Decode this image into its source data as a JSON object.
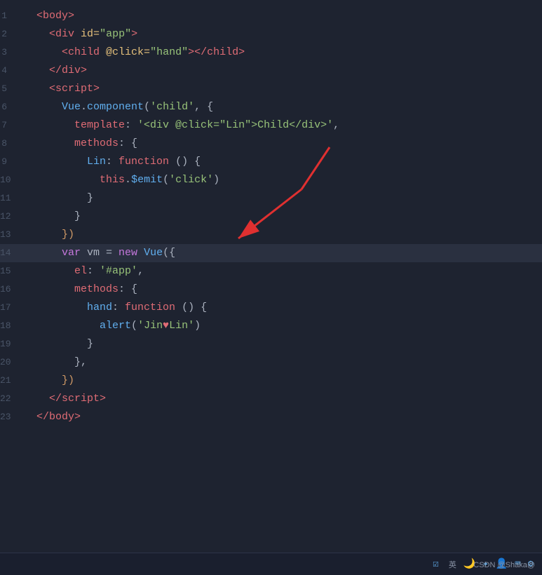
{
  "editor": {
    "background": "#1e2330",
    "lines": [
      {
        "num": "1",
        "tokens": [
          {
            "text": "  <",
            "class": "c-tag"
          },
          {
            "text": "body",
            "class": "c-tag"
          },
          {
            "text": ">",
            "class": "c-tag"
          }
        ]
      },
      {
        "num": "2",
        "tokens": [
          {
            "text": "    <",
            "class": "c-tag"
          },
          {
            "text": "div",
            "class": "c-tag"
          },
          {
            "text": " ",
            "class": "c-white"
          },
          {
            "text": "id=",
            "class": "c-attr"
          },
          {
            "text": "\"app\"",
            "class": "c-string"
          },
          {
            "text": ">",
            "class": "c-tag"
          }
        ]
      },
      {
        "num": "3",
        "tokens": [
          {
            "text": "      <",
            "class": "c-tag"
          },
          {
            "text": "child",
            "class": "c-tag"
          },
          {
            "text": " ",
            "class": "c-white"
          },
          {
            "text": "@click=",
            "class": "c-attr"
          },
          {
            "text": "\"hand\"",
            "class": "c-string"
          },
          {
            "text": ">",
            "class": "c-tag"
          },
          {
            "text": "</",
            "class": "c-tag"
          },
          {
            "text": "child",
            "class": "c-tag"
          },
          {
            "text": ">",
            "class": "c-tag"
          }
        ]
      },
      {
        "num": "4",
        "tokens": [
          {
            "text": "    </",
            "class": "c-tag"
          },
          {
            "text": "div",
            "class": "c-tag"
          },
          {
            "text": ">",
            "class": "c-tag"
          }
        ]
      },
      {
        "num": "5",
        "tokens": [
          {
            "text": "    <",
            "class": "c-tag"
          },
          {
            "text": "script",
            "class": "c-tag"
          },
          {
            "text": ">",
            "class": "c-tag"
          }
        ]
      },
      {
        "num": "6",
        "tokens": [
          {
            "text": "      ",
            "class": "c-white"
          },
          {
            "text": "Vue",
            "class": "c-vue"
          },
          {
            "text": ".",
            "class": "c-white"
          },
          {
            "text": "component",
            "class": "c-method"
          },
          {
            "text": "(",
            "class": "c-white"
          },
          {
            "text": "'child'",
            "class": "c-string"
          },
          {
            "text": ", {",
            "class": "c-white"
          }
        ]
      },
      {
        "num": "7",
        "tokens": [
          {
            "text": "        ",
            "class": "c-white"
          },
          {
            "text": "template",
            "class": "c-prop"
          },
          {
            "text": ": ",
            "class": "c-white"
          },
          {
            "text": "'<div @click=\"Lin\">Child</div>'",
            "class": "c-string"
          },
          {
            "text": ",",
            "class": "c-white"
          }
        ]
      },
      {
        "num": "8",
        "tokens": [
          {
            "text": "        ",
            "class": "c-white"
          },
          {
            "text": "methods",
            "class": "c-prop"
          },
          {
            "text": ": {",
            "class": "c-white"
          }
        ]
      },
      {
        "num": "9",
        "tokens": [
          {
            "text": "          ",
            "class": "c-white"
          },
          {
            "text": "Lin",
            "class": "c-blue"
          },
          {
            "text": ": ",
            "class": "c-white"
          },
          {
            "text": "function",
            "class": "c-func"
          },
          {
            "text": " () {",
            "class": "c-white"
          }
        ]
      },
      {
        "num": "10",
        "tokens": [
          {
            "text": "            ",
            "class": "c-white"
          },
          {
            "text": "this",
            "class": "c-this"
          },
          {
            "text": ".",
            "class": "c-white"
          },
          {
            "text": "$emit",
            "class": "c-method"
          },
          {
            "text": "(",
            "class": "c-white"
          },
          {
            "text": "'click'",
            "class": "c-string"
          },
          {
            "text": ")",
            "class": "c-white"
          }
        ]
      },
      {
        "num": "11",
        "tokens": [
          {
            "text": "          ",
            "class": "c-white"
          },
          {
            "text": "}",
            "class": "c-white"
          }
        ]
      },
      {
        "num": "12",
        "tokens": [
          {
            "text": "        ",
            "class": "c-white"
          },
          {
            "text": "}",
            "class": "c-white"
          }
        ]
      },
      {
        "num": "13",
        "tokens": [
          {
            "text": "      ",
            "class": "c-white"
          },
          {
            "text": "})",
            "class": "c-orange"
          }
        ]
      },
      {
        "num": "14",
        "tokens": [
          {
            "text": "      ",
            "class": "c-white"
          },
          {
            "text": "var",
            "class": "c-keyword"
          },
          {
            "text": " vm = ",
            "class": "c-white"
          },
          {
            "text": "new",
            "class": "c-keyword"
          },
          {
            "text": " ",
            "class": "c-white"
          },
          {
            "text": "Vue",
            "class": "c-vue"
          },
          {
            "text": "({",
            "class": "c-white"
          }
        ],
        "highlighted": true
      },
      {
        "num": "15",
        "tokens": [
          {
            "text": "        ",
            "class": "c-white"
          },
          {
            "text": "el",
            "class": "c-prop"
          },
          {
            "text": ": ",
            "class": "c-white"
          },
          {
            "text": "'#app'",
            "class": "c-string"
          },
          {
            "text": ",",
            "class": "c-white"
          }
        ]
      },
      {
        "num": "16",
        "tokens": [
          {
            "text": "        ",
            "class": "c-white"
          },
          {
            "text": "methods",
            "class": "c-prop"
          },
          {
            "text": ": {",
            "class": "c-white"
          }
        ]
      },
      {
        "num": "17",
        "tokens": [
          {
            "text": "          ",
            "class": "c-white"
          },
          {
            "text": "hand",
            "class": "c-blue"
          },
          {
            "text": ": ",
            "class": "c-white"
          },
          {
            "text": "function",
            "class": "c-func"
          },
          {
            "text": " () {",
            "class": "c-white"
          }
        ]
      },
      {
        "num": "18",
        "tokens": [
          {
            "text": "            ",
            "class": "c-white"
          },
          {
            "text": "alert",
            "class": "c-method"
          },
          {
            "text": "(",
            "class": "c-white"
          },
          {
            "text": "'Jin",
            "class": "c-string"
          },
          {
            "text": "♥",
            "class": "c-heart"
          },
          {
            "text": "Lin'",
            "class": "c-string"
          },
          {
            "text": ")",
            "class": "c-white"
          }
        ]
      },
      {
        "num": "19",
        "tokens": [
          {
            "text": "          ",
            "class": "c-white"
          },
          {
            "text": "}",
            "class": "c-white"
          }
        ]
      },
      {
        "num": "20",
        "tokens": [
          {
            "text": "        ",
            "class": "c-white"
          },
          {
            "text": "},",
            "class": "c-white"
          }
        ]
      },
      {
        "num": "21",
        "tokens": [
          {
            "text": "      ",
            "class": "c-white"
          },
          {
            "text": "})",
            "class": "c-orange"
          }
        ]
      },
      {
        "num": "22",
        "tokens": [
          {
            "text": "    </",
            "class": "c-tag"
          },
          {
            "text": "script",
            "class": "c-tag"
          },
          {
            "text": ">",
            "class": "c-tag"
          }
        ]
      },
      {
        "num": "23",
        "tokens": [
          {
            "text": "  </",
            "class": "c-tag"
          },
          {
            "text": "body",
            "class": "c-tag"
          },
          {
            "text": ">",
            "class": "c-tag"
          }
        ]
      }
    ]
  },
  "statusBar": {
    "items": [
      "英",
      "🌙",
      "✦",
      "👤",
      "⌨",
      "⚙"
    ],
    "csdn": "CSDN @Shaka@"
  }
}
